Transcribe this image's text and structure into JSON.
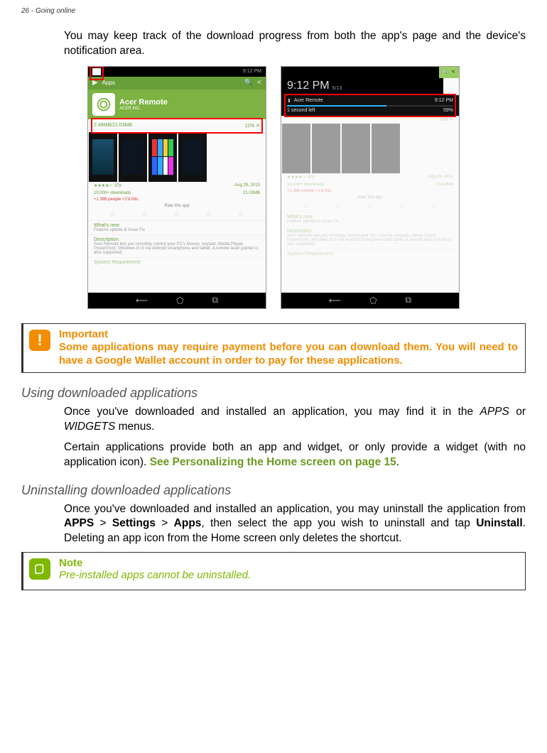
{
  "header": "26 - Going online",
  "intro": "You may keep track of the download progress from both the app's page and the device's notification area.",
  "phone1": {
    "statusTime": "9:12 PM",
    "appbarTitle": "Apps",
    "heroName": "Acer Remote",
    "heroPub": "ACER INC.",
    "progressText": "2.48MB/21.03MB",
    "progressPct": "11%",
    "ratingCount": "379",
    "downloads": "10,000+ downloads",
    "date": "Aug 29, 2013",
    "size": "21.03MB",
    "plus1": "+1  386 people +1'd this.",
    "rateLabel": "Rate this app",
    "whatsNew": "What's new",
    "whatsNewBody": "Feature update & Issue Fix",
    "description": "Description",
    "descriptionBody": "Acer Remote lets you remotely control your PC's Mouse, keypad, Media Player, PowerPoint, Windows 8 UI via Android smartphone and tablet. A remote laser pointer is also supported.",
    "sysReq": "System Requirement"
  },
  "phone2": {
    "shadeTime": "9:12 PM",
    "shadeDate": "5/13",
    "notifTitle": "Acer Remote",
    "notifTime": "9:12 PM",
    "notifSub": "1 second left",
    "notifPct": "59%"
  },
  "callout1": {
    "title": "Important",
    "body": "Some applications may require payment before you can download them. You will need to have a Google Wallet account in order to pay for these applications."
  },
  "h3a": "Using downloaded applications",
  "p2a": "Once you've downloaded and installed an application, you may find it in the ",
  "p2_apps": "APPS",
  "p2_or": " or ",
  "p2_widgets": "WIDGETS",
  "p2_end": " menus.",
  "p3a": "Certain applications provide both an app and widget, or only provide a widget (with no application icon). ",
  "p3_link": "See Personalizing the Home screen on page 15",
  "h3b": "Uninstalling downloaded applications",
  "p4a": "Once you've downloaded and installed an application, you may uninstall the application from ",
  "p4_apps": "APPS",
  "p4_gt1": " > ",
  "p4_settings": "Settings",
  "p4_gt2": " > ",
  "p4_apps2": "Apps",
  "p4_mid": ", then select the app you wish to uninstall and tap ",
  "p4_uninstall": "Uninstall",
  "p4_end": ". Deleting an app icon from the Home screen only deletes the shortcut.",
  "callout2": {
    "title": "Note",
    "body": "Pre-installed apps cannot be uninstalled."
  }
}
